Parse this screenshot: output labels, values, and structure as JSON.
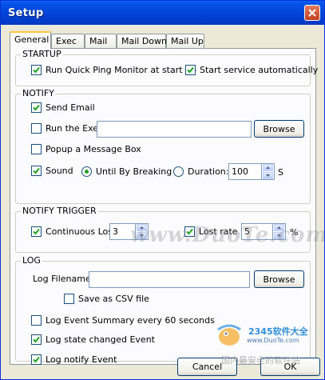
{
  "window": {
    "title": "Setup"
  },
  "tabs": [
    "General",
    "Exec",
    "Mail",
    "Mail Down",
    "Mail Up"
  ],
  "active_tab": "General",
  "startup": {
    "label": "STARTUP",
    "run_at_startup": {
      "label": "Run Quick Ping Monitor at start up",
      "checked": true
    },
    "start_service": {
      "label": "Start service automatically",
      "checked": true
    }
  },
  "notify": {
    "label": "NOTIFY",
    "send_email": {
      "label": "Send Email",
      "checked": true
    },
    "run_exe": {
      "label": "Run the Exe:",
      "checked": false,
      "value": ""
    },
    "browse_label": "Browse",
    "popup": {
      "label": "Popup a Message Box",
      "checked": false
    },
    "sound": {
      "label": "Sound",
      "checked": true
    },
    "until_breaking": {
      "label": "Until By Breaking",
      "selected": true
    },
    "duration": {
      "label": "Duration:",
      "selected": false,
      "value": "100",
      "unit": "S"
    }
  },
  "trigger": {
    "label": "NOTIFY TRIGGER",
    "continuous_lost": {
      "label": "Continuous Lost",
      "checked": true,
      "value": "3"
    },
    "lost_rate": {
      "label": "Lost rate",
      "checked": true,
      "value": "5",
      "unit": "%"
    }
  },
  "log": {
    "label": "LOG",
    "filename_label": "Log Filename:",
    "filename_value": "",
    "browse_label": "Browse",
    "save_csv": {
      "label": "Save as CSV file",
      "checked": false
    },
    "event_summary": {
      "label": "Log Event Summary every 60 seconds",
      "checked": false
    },
    "state_changed": {
      "label": "Log state changed Event",
      "checked": true
    },
    "notify_event": {
      "label": "Log notify Event",
      "checked": true
    }
  },
  "footer": {
    "cancel_label": "Cancel",
    "ok_label": "OK"
  },
  "watermarks": {
    "duote": "www.DuoTe.com",
    "brand": "2345软件大全",
    "url": "www.DuoTe.com",
    "cn": "国内最安全的软件站"
  }
}
